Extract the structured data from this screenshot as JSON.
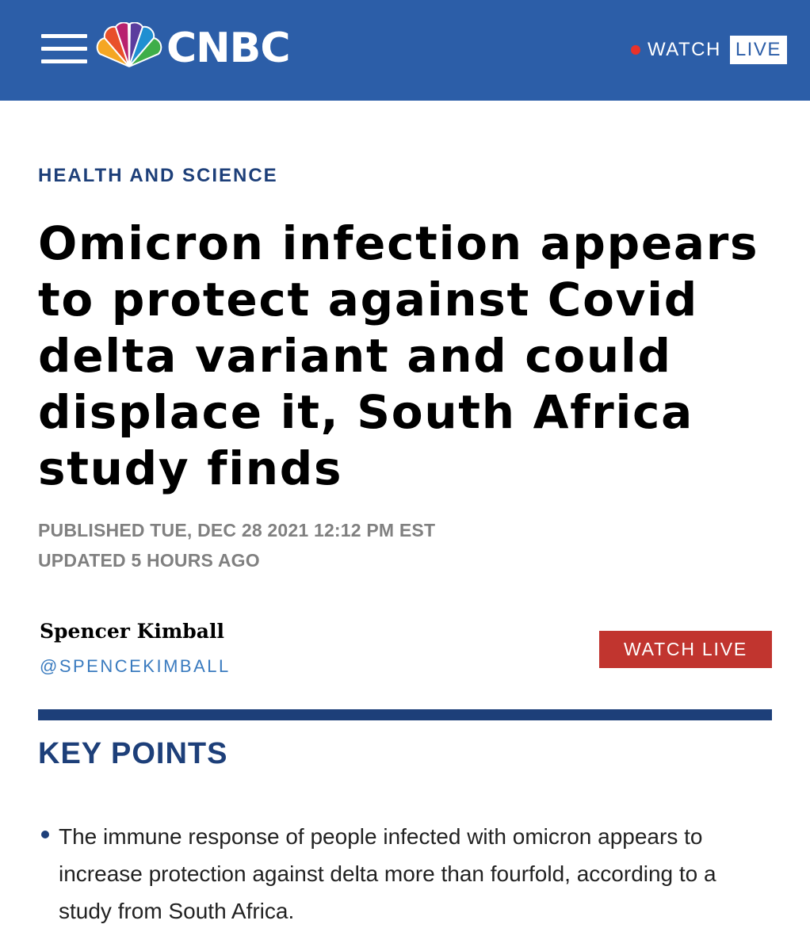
{
  "header": {
    "brand": "CNBC",
    "watch_label": "WATCH",
    "live_label": "LIVE",
    "bg_color": "#2c5ea8"
  },
  "article": {
    "section": "HEALTH AND SCIENCE",
    "headline": "Omicron infection appears to protect against Covid delta variant and could displace it, South Africa study finds",
    "published": "PUBLISHED TUE, DEC 28 2021 12:12 PM EST",
    "updated": "UPDATED 5 HOURS AGO",
    "author": {
      "name": "Spencer Kimball",
      "handle": "@SPENCEKIMBALL"
    },
    "watch_live_button": "WATCH LIVE"
  },
  "key_points": {
    "title": "KEY POINTS",
    "items": [
      "The immune response of people infected with omicron appears to increase protection against delta more than fourfold, according to a study from South Africa."
    ]
  },
  "colors": {
    "accent_navy": "#1d3f79",
    "live_red": "#c1352f",
    "handle_blue": "#3a7bbf"
  },
  "icons": [
    "menu-icon",
    "peacock-logo-icon",
    "live-dot-icon",
    "bullet-icon"
  ]
}
